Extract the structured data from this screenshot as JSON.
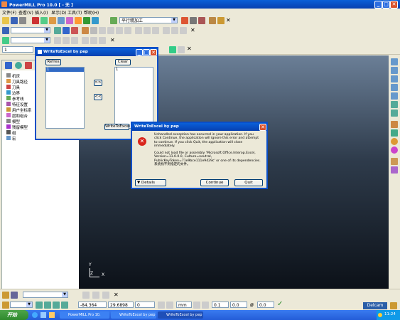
{
  "app": {
    "title": "PowerMILL Pro 10.0    [ - 无 ]",
    "menu": [
      "文件(F)",
      "查看(V)",
      "插入(I)",
      "显示(D)",
      "工具(T)",
      "帮助(H)"
    ],
    "plane_combo": "平行精加工",
    "second_combo": "1"
  },
  "explorer": {
    "items": [
      "机床",
      "刀具路径",
      "刀具",
      "边界",
      "参考线",
      "特征设置",
      "用户坐标系",
      "层和组合",
      "模型",
      "残留模型",
      "组",
      "宏"
    ]
  },
  "write_excel_window": {
    "title": "WriteToExcel by pep",
    "refresh_label": "Refres",
    "clear_label": "Clear",
    "left_list_first": "1",
    "right_list_first": "1",
    "move_right_label": ">>",
    "move_left_label": "<<",
    "write_button_label": "WriteToExcel"
  },
  "error_dialog": {
    "title": "WriteToExcel by pep",
    "message_1": "Unhandled exception has occurred in your application. If you click Continue, the application will ignore this error and attempt to continue. If you click Quit, the application will close immediately.",
    "message_2": "Could not load file or assembly 'Microsoft.Office.Interop.Excel, Version=11.0.0.0, Culture=neutral, PublicKeyToken=71e9bce111e9429c' or one of its dependencies. 系统找不到指定的文件。",
    "details_label": "Details",
    "continue_label": "Continue",
    "quit_label": "Quit"
  },
  "statusbar": {
    "coord_x": "-84.364",
    "coord_y": "29.6898",
    "coord_z": "0",
    "unit": "mm",
    "tol": "0.1",
    "thickness": "0.0",
    "angle": "0.0",
    "brand": "Delcam"
  },
  "axes": {
    "y": "Y",
    "z": "Z",
    "x": "X"
  },
  "taskbar": {
    "start": "开始",
    "tasks": [
      "PowerMILL Pro 10.",
      "WriteToExcel by pep",
      "WriteToExcel by pep"
    ],
    "clock": "11:24"
  },
  "colors": {
    "viewport_top": "#6b7f97",
    "viewport_bottom": "#0c1118",
    "xp_blue": "#0a5fd8",
    "error_red": "#d9251c"
  }
}
